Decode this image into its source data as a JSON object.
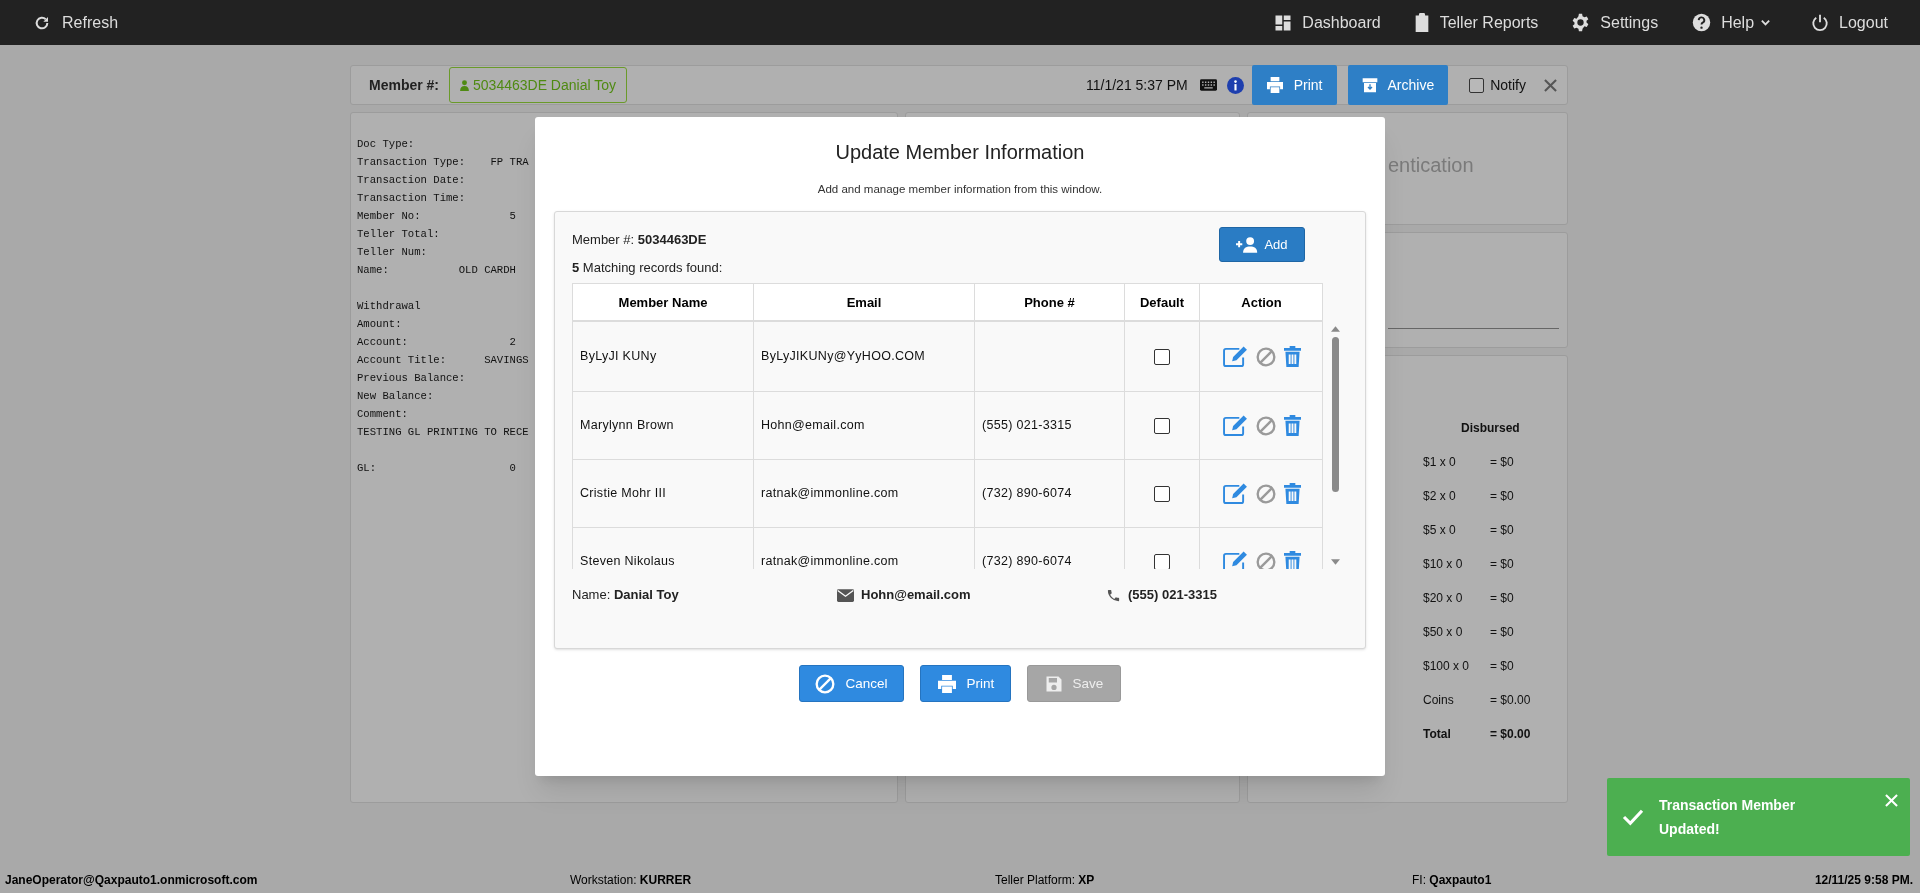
{
  "top_bar": {
    "refresh": "Refresh",
    "nav": [
      "Dashboard",
      "Teller Reports",
      "Settings",
      "Help",
      "Logout"
    ]
  },
  "member_header": {
    "label": "Member #:",
    "member_badge": "5034463DE Danial Toy",
    "datetime": "11/1/21 5:37 PM",
    "buttons": [
      "Print",
      "Archive"
    ],
    "notify": {
      "label": "Notify",
      "checked": false
    }
  },
  "receipt": {
    "sections": [
      [
        "Doc Type:",
        "Transaction Type:    FP TRA",
        "Transaction Date:",
        "Transaction Time:",
        "Member No:              5",
        "Teller Total:",
        "Teller Num:",
        "Name:           OLD CARDH"
      ],
      [
        "Withdrawal",
        "Amount:",
        "Account:                2",
        "Account Title:      SAVINGS",
        "Previous Balance:",
        "New Balance:",
        "Comment:",
        "TESTING GL PRINTING TO RECE"
      ],
      [
        "GL:                     0"
      ]
    ]
  },
  "right_panels": {
    "heading": "entication",
    "disbursed": {
      "title": "Disbursed",
      "rows": [
        {
          "kind": "line",
          "denomination": "$1 x 0",
          "amount": "= $0"
        },
        {
          "kind": "line",
          "denomination": "$2 x 0",
          "amount": "= $0"
        },
        {
          "kind": "line",
          "denomination": "$5 x 0",
          "amount": "= $0"
        },
        {
          "kind": "line",
          "denomination": "$10 x 0",
          "amount": "= $0"
        },
        {
          "kind": "line",
          "denomination": "$20 x 0",
          "amount": "= $0"
        },
        {
          "kind": "line",
          "denomination": "$50 x 0",
          "amount": "= $0"
        },
        {
          "kind": "line",
          "denomination": "$100 x 0",
          "amount": "= $0"
        },
        {
          "kind": "line",
          "denomination": "Coins",
          "amount": "= $0.00"
        },
        {
          "kind": "total",
          "denomination": "Total",
          "amount": "= $0.00"
        }
      ]
    }
  },
  "modal": {
    "title": "Update Member Information",
    "subtitle": "Add and manage member information from this window.",
    "member_label": "Member #:",
    "member_number": "5034463DE",
    "add_button": "Add",
    "match_count": "5",
    "match_text": "Matching records found:",
    "table": {
      "columns": [
        "Member Name",
        "Email",
        "Phone #",
        "Default",
        "Action"
      ],
      "rows": [
        {
          "member_name": "ByLyJI KUNy",
          "email": "ByLyJIKUNy@YyHOO.COM",
          "default": false
        },
        {
          "member_name": "Marylynn Brown",
          "email": "Hohn@email.com",
          "phone": "(555) 021-3315",
          "default": false
        },
        {
          "member_name": "Cristie Mohr III",
          "email": "ratnak@immonline.com",
          "phone": "(732) 890-6074",
          "default": false
        },
        {
          "member_name": "Steven Nikolaus",
          "email": "ratnak@immonline.com",
          "phone": "(732) 890-6074",
          "default": false
        }
      ]
    },
    "summary": {
      "name_label": "Name:",
      "name": "Danial Toy",
      "email": "Hohn@email.com",
      "phone": "(555) 021-3315"
    },
    "buttons": [
      {
        "kind": "cancel",
        "label": "Cancel",
        "disabled": false
      },
      {
        "kind": "print",
        "label": "Print",
        "disabled": false
      },
      {
        "kind": "save",
        "label": "Save",
        "disabled": true
      }
    ]
  },
  "toast": {
    "message": "Transaction Member Updated!"
  },
  "status_bar": {
    "user": "JaneOperator@Qaxpauto1.onmicrosoft.com",
    "workstation": {
      "label": "Workstation:",
      "value": "KURRER"
    },
    "platform": {
      "label": "Teller Platform:",
      "value": "XP"
    },
    "fi": {
      "label": "FI:",
      "value": "Qaxpauto1"
    },
    "datetime": "12/11/25 9:58 PM."
  }
}
